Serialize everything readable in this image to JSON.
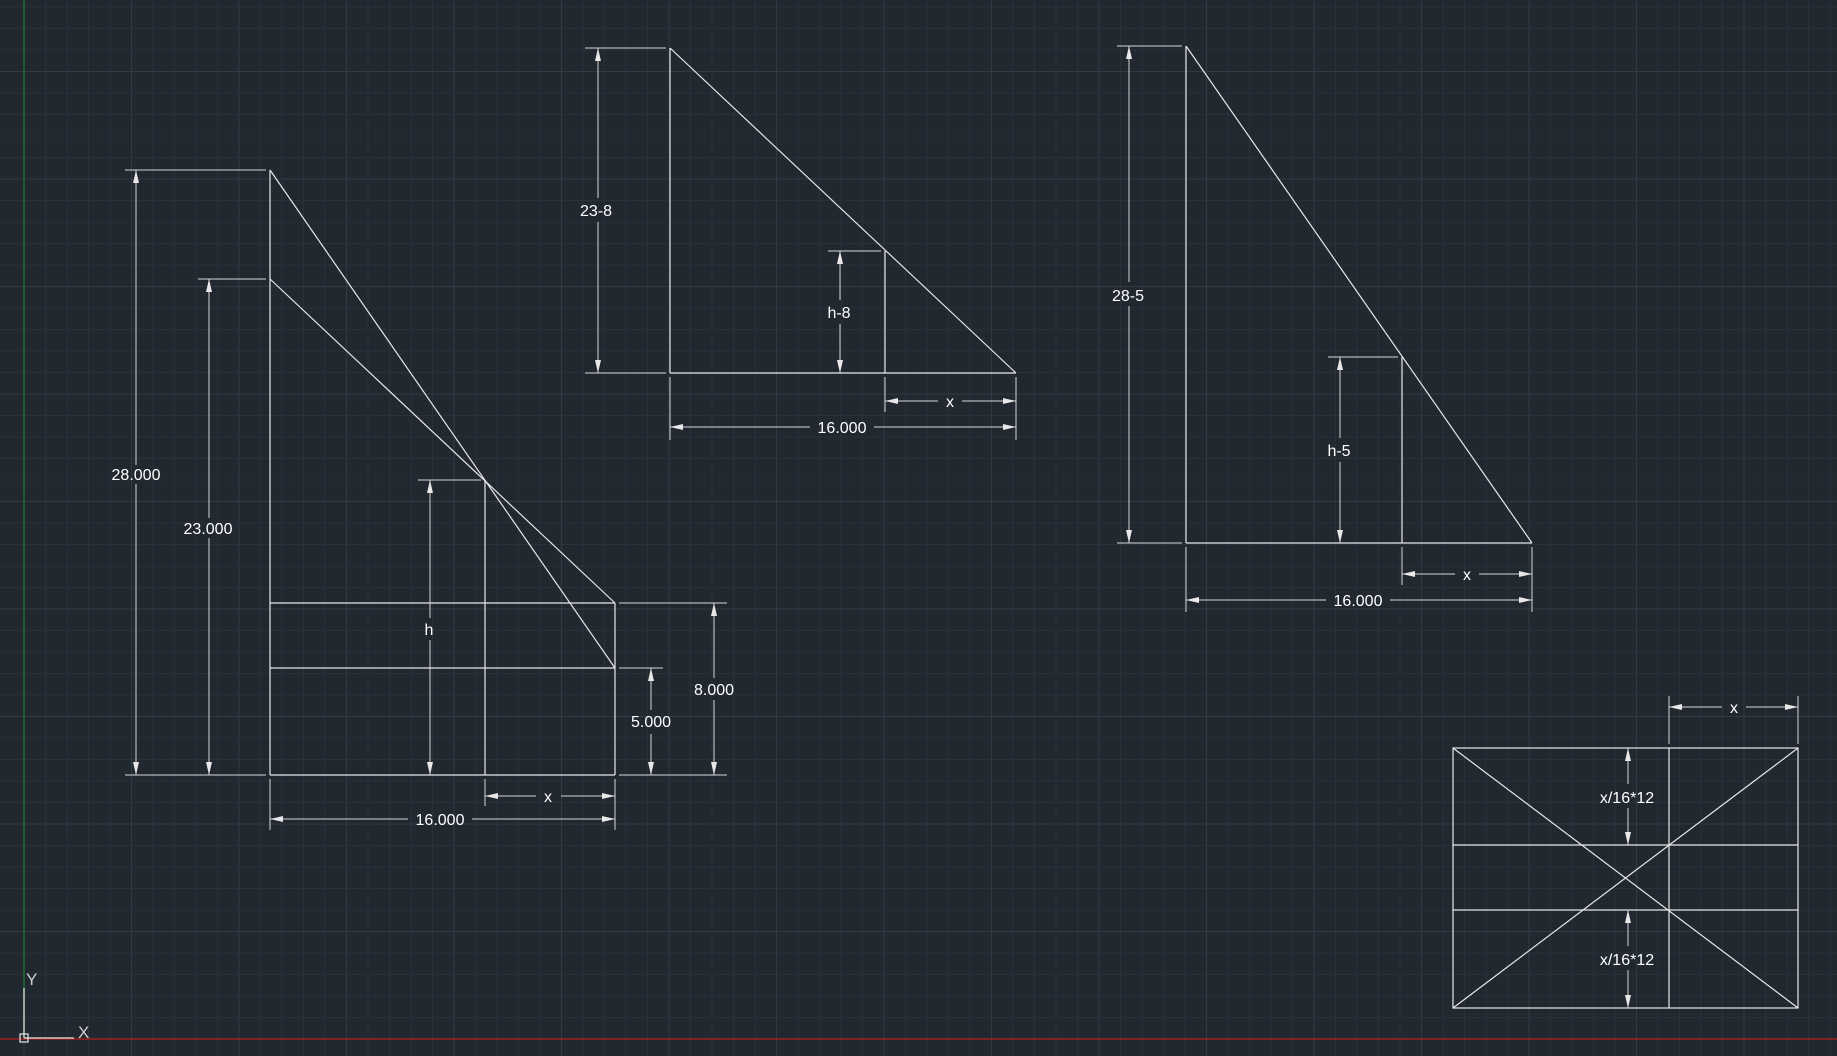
{
  "app": "CAD model space",
  "colors": {
    "background": "#212830",
    "grid_minor": "#2a313a",
    "grid_major": "#323a44",
    "geometry": "#e8e8e8",
    "x_axis": "#a02020",
    "y_axis": "#1f6d2a"
  },
  "ucs": {
    "x_label": "X",
    "y_label": "Y"
  },
  "figure_main": {
    "dim_28": "28.000",
    "dim_23": "23.000",
    "dim_h": "h",
    "dim_8": "8.000",
    "dim_5": "5.000",
    "dim_x": "x",
    "dim_16": "16.000"
  },
  "figure_top": {
    "dim_23_8": "23-8",
    "dim_h_8": "h-8",
    "dim_x": "x",
    "dim_16": "16.000"
  },
  "figure_right": {
    "dim_28_5": "28-5",
    "dim_h_5": "h-5",
    "dim_x": "x",
    "dim_16": "16.000"
  },
  "figure_rect": {
    "dim_x": "x",
    "dim_upper": "x/16*12",
    "dim_lower": "x/16*12"
  }
}
